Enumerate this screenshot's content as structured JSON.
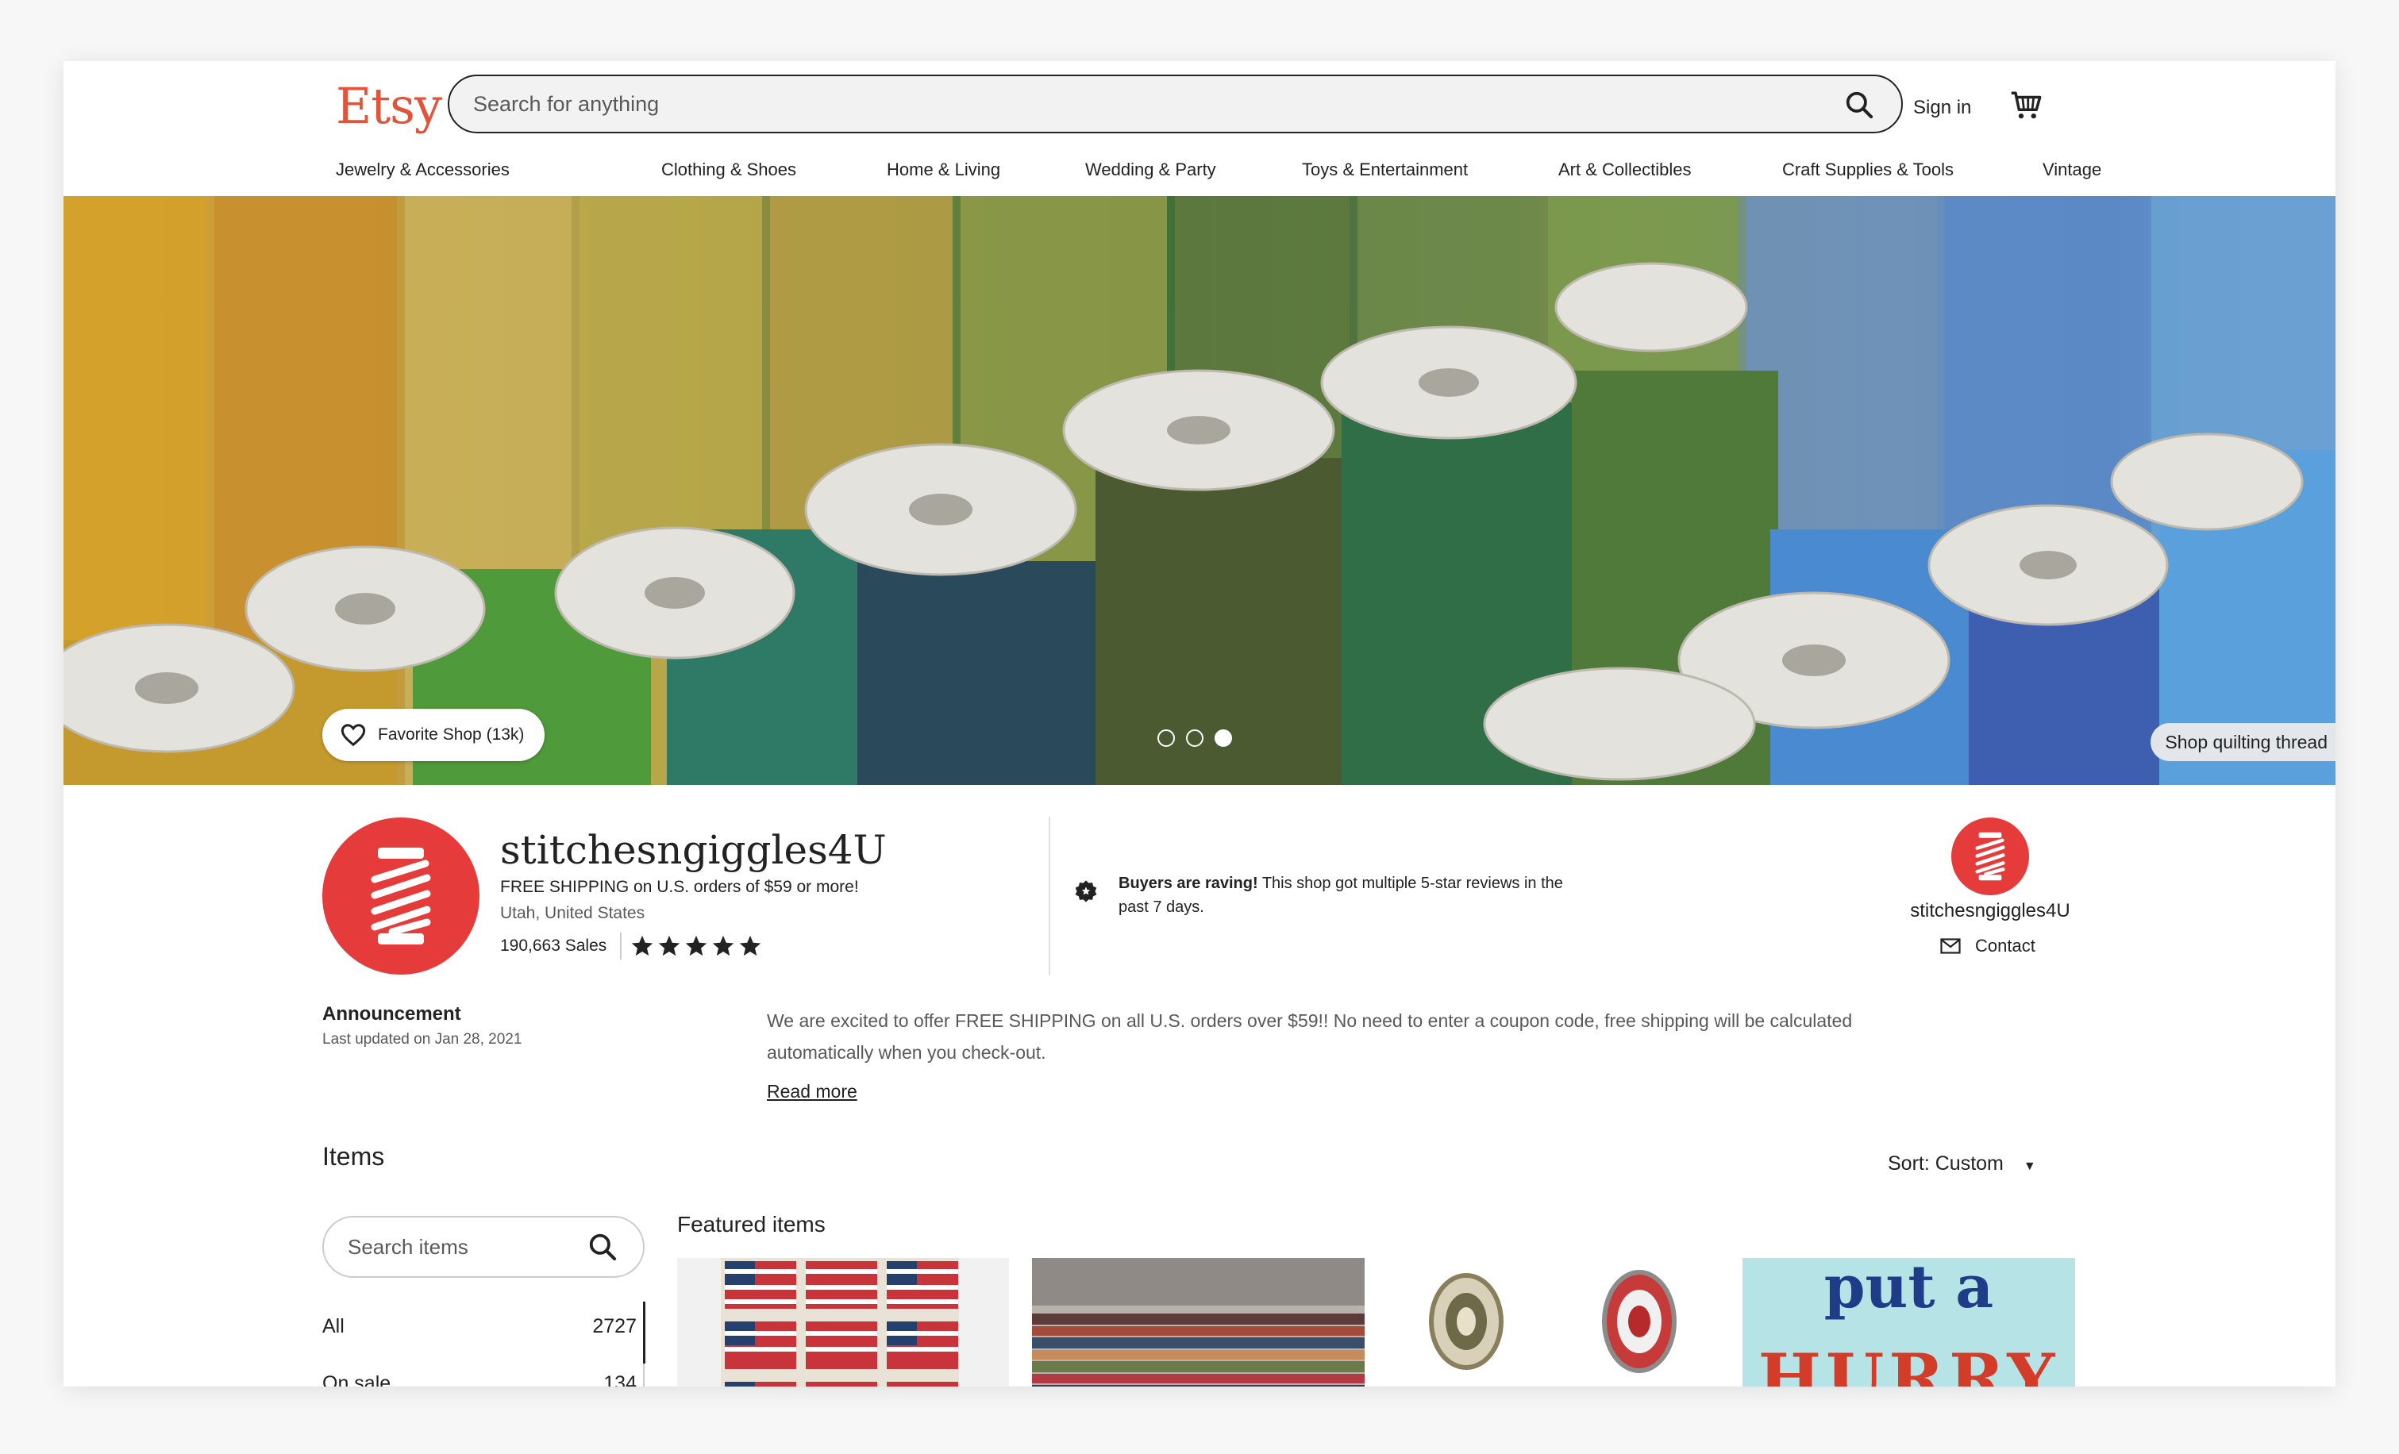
{
  "header": {
    "logo": "Etsy",
    "search_placeholder": "Search for anything",
    "sign_in": "Sign in"
  },
  "nav": {
    "items": [
      "Jewelry & Accessories",
      "Clothing & Shoes",
      "Home & Living",
      "Wedding & Party",
      "Toys & Entertainment",
      "Art & Collectibles",
      "Craft Supplies & Tools",
      "Vintage"
    ]
  },
  "banner": {
    "favorite_label": "Favorite Shop (13k)",
    "carousel_active_index": 2,
    "carousel_count": 3,
    "shop_link": "Shop quilting thread"
  },
  "shop": {
    "name": "stitchesngiggles4U",
    "shipping": "FREE SHIPPING on U.S. orders of $59 or more!",
    "location": "Utah, United States",
    "sales": "190,663 Sales",
    "rating_stars": 5
  },
  "raving": {
    "bold": "Buyers are raving!",
    "text": " This shop got multiple 5-star reviews in the past 7 days."
  },
  "owner": {
    "name": "stitchesngiggles4U",
    "contact": "Contact"
  },
  "announcement": {
    "title": "Announcement",
    "updated": "Last updated on Jan 28, 2021",
    "body": "We are excited to offer FREE SHIPPING on all U.S. orders over $59!! No need to enter a coupon code, free shipping will be calculated automatically when you check-out.",
    "read_more": "Read more"
  },
  "items": {
    "heading": "Items",
    "sort_label": "Sort: Custom",
    "search_placeholder": "Search items",
    "filters": [
      {
        "label": "All",
        "count": "2727"
      },
      {
        "label": "On sale",
        "count": "134"
      }
    ],
    "featured_heading": "Featured items",
    "featured_thumb_4_text": [
      "put a",
      "HURRY"
    ]
  },
  "colors": {
    "brand": "#e1543a",
    "shop_red": "#e63b3b"
  }
}
